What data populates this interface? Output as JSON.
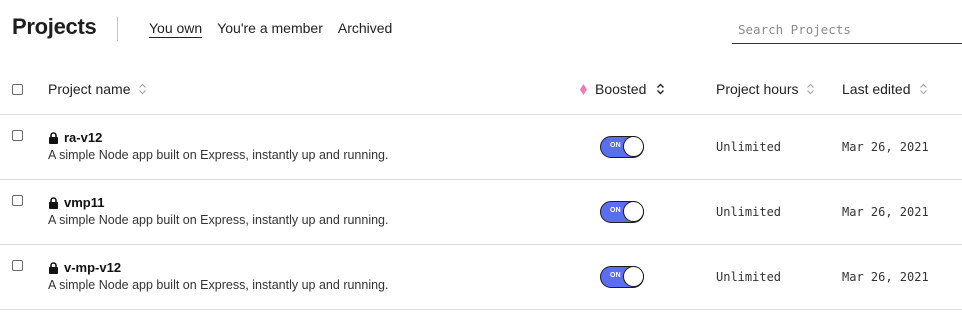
{
  "header": {
    "title": "Projects",
    "tabs": [
      {
        "label": "You own",
        "active": true
      },
      {
        "label": "You're a member",
        "active": false
      },
      {
        "label": "Archived",
        "active": false
      }
    ],
    "search": {
      "placeholder": "Search Projects",
      "value": ""
    }
  },
  "table": {
    "columns": {
      "name": "Project name",
      "boosted": "Boosted",
      "hours": "Project hours",
      "edited": "Last edited"
    },
    "sorted_column": "boosted",
    "rows": [
      {
        "name": "ra-v12",
        "description": "A simple Node app built on Express, instantly up and running.",
        "boosted": "ON",
        "hours": "Unlimited",
        "edited": "Mar 26, 2021",
        "private": true
      },
      {
        "name": "vmp11",
        "description": "A simple Node app built on Express, instantly up and running.",
        "boosted": "ON",
        "hours": "Unlimited",
        "edited": "Mar 26, 2021",
        "private": true
      },
      {
        "name": "v-mp-v12",
        "description": "A simple Node app built on Express, instantly up and running.",
        "boosted": "ON",
        "hours": "Unlimited",
        "edited": "Mar 26, 2021",
        "private": true
      }
    ]
  },
  "icons": {
    "sort": "sort-updown-icon",
    "sort_active": "chevron-updown-icon",
    "boost": "gem-icon",
    "private": "lock-icon"
  },
  "colors": {
    "toggle_on": "#5b6ef0",
    "gem": "#f07ab8"
  }
}
